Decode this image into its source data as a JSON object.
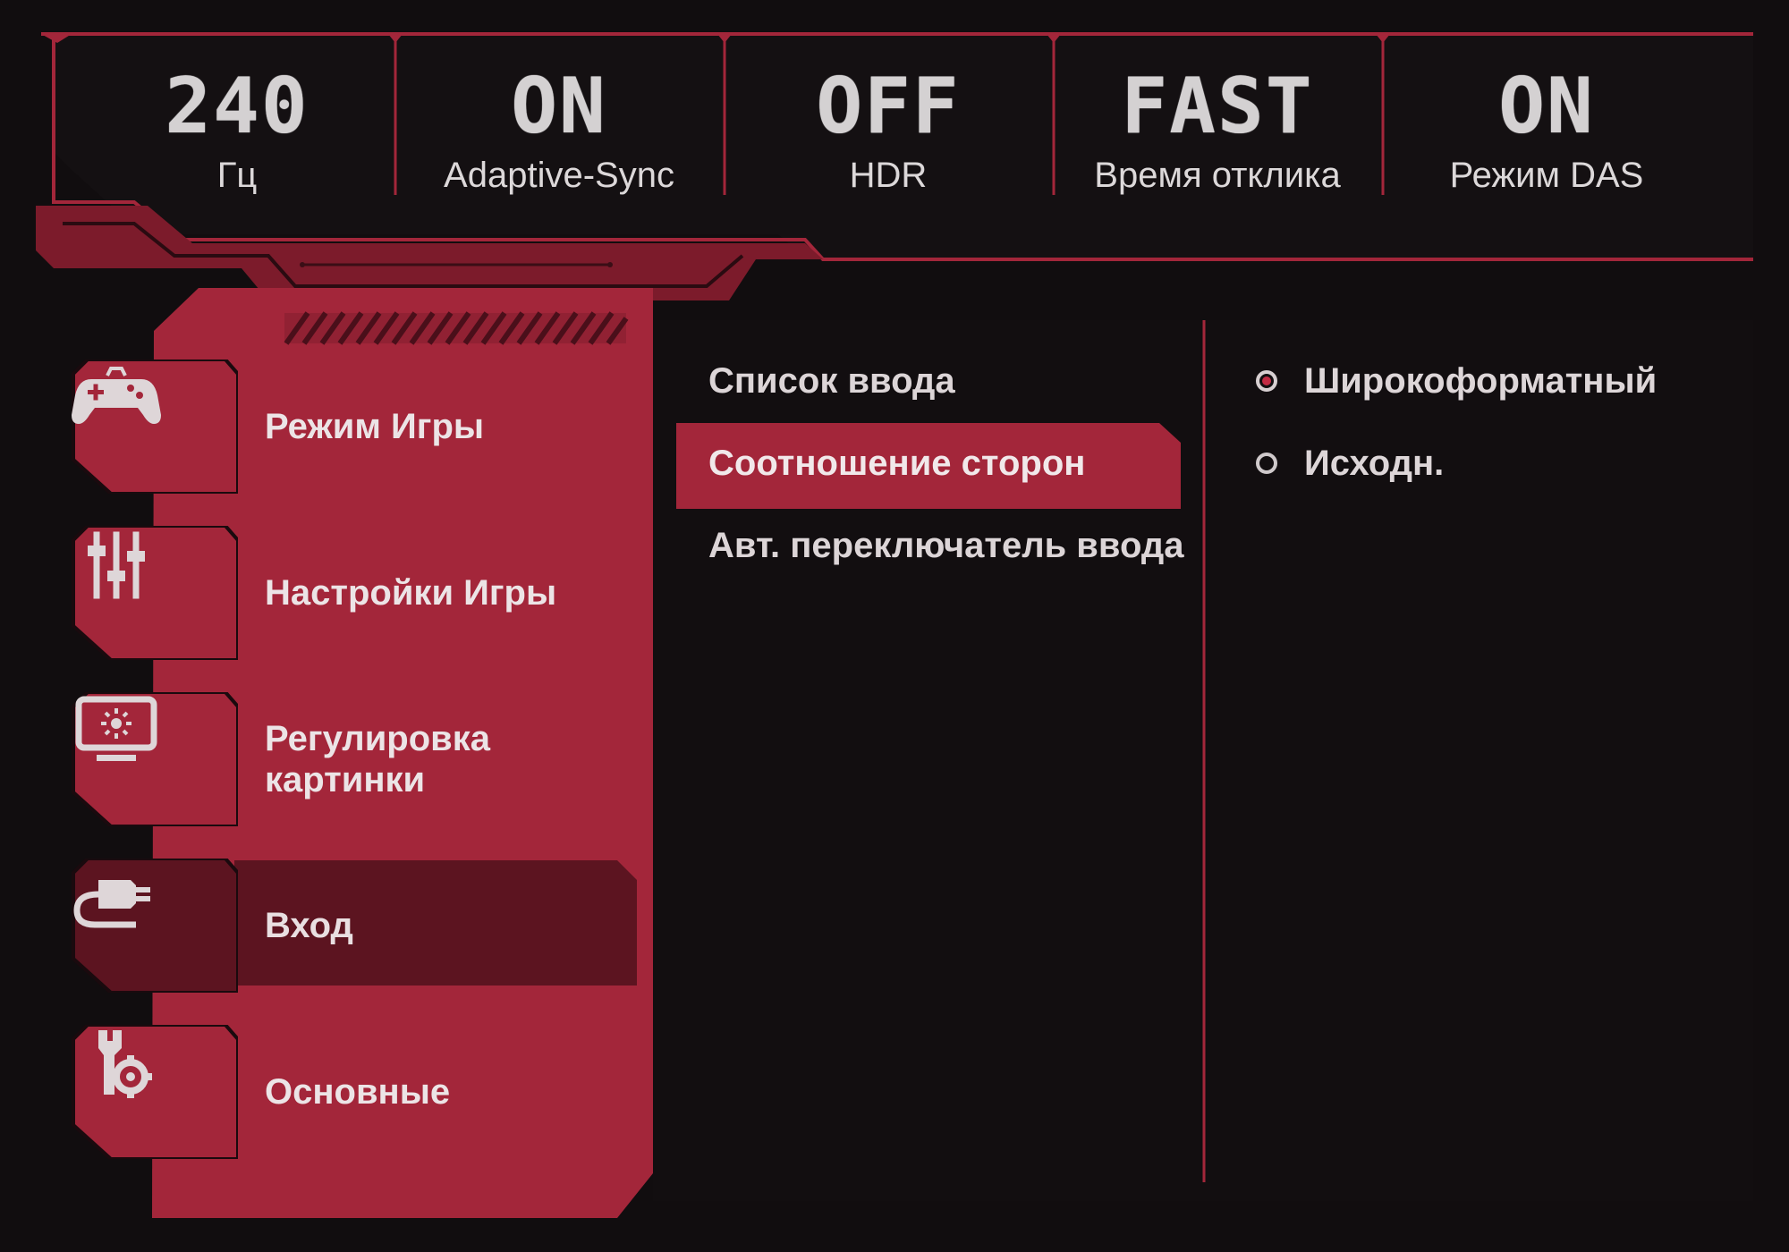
{
  "colors": {
    "accent": "#a3263a",
    "accent_dark": "#5c1420",
    "panel_bg": "#110d0f",
    "text": "#e4dfe0"
  },
  "status_bar": [
    {
      "value": "240",
      "label": "Гц"
    },
    {
      "value": "ON",
      "label": "Adaptive-Sync"
    },
    {
      "value": "OFF",
      "label": "HDR"
    },
    {
      "value": "FAST",
      "label": "Время отклика"
    },
    {
      "value": "ON",
      "label": "Режим DAS"
    }
  ],
  "menu": {
    "items": [
      {
        "label": "Режим Игры",
        "icon": "gamepad-icon"
      },
      {
        "label": "Настройки Игры",
        "icon": "sliders-icon"
      },
      {
        "label": "Регулировка картинки",
        "icon": "monitor-brightness-icon"
      },
      {
        "label": "Вход",
        "icon": "input-plug-icon"
      },
      {
        "label": "Основные",
        "icon": "wrench-gear-icon"
      }
    ],
    "active_index": 3
  },
  "submenu": {
    "options": [
      {
        "label": "Список ввода"
      },
      {
        "label": "Соотношение сторон"
      },
      {
        "label": "Авт. переключатель ввода"
      }
    ],
    "highlighted_index": 1
  },
  "values": {
    "options": [
      {
        "label": "Широкоформатный",
        "selected": true
      },
      {
        "label": "Исходн.",
        "selected": false
      }
    ]
  }
}
